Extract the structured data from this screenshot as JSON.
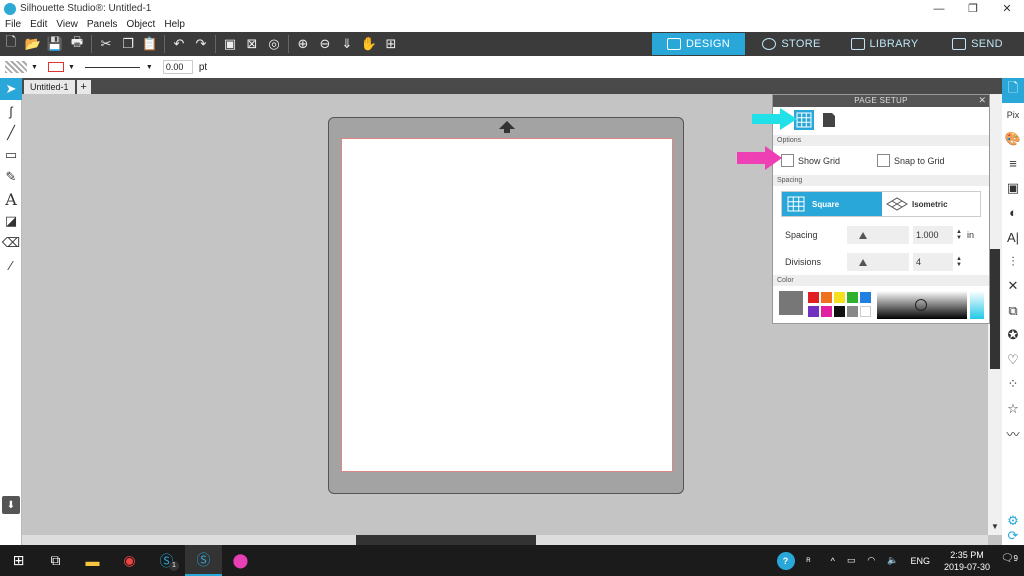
{
  "window": {
    "title": "Silhouette Studio®: Untitled-1",
    "minimize": "—",
    "maximize": "❐",
    "close": "✕"
  },
  "menu": [
    "File",
    "Edit",
    "View",
    "Panels",
    "Object",
    "Help"
  ],
  "nav_tabs": {
    "design": "DESIGN",
    "store": "STORE",
    "library": "LIBRARY",
    "send": "SEND"
  },
  "props": {
    "line_width": "0.00",
    "unit": "pt"
  },
  "doc_tab": {
    "name": "Untitled-1",
    "add": "+"
  },
  "panel": {
    "title": "PAGE SETUP",
    "options_label": "Options",
    "show_grid": "Show Grid",
    "snap_to_grid": "Snap to Grid",
    "spacing_label": "Spacing",
    "square": "Square",
    "isometric": "Isometric",
    "spacing": "Spacing",
    "spacing_value": "1.000",
    "spacing_unit": "in",
    "divisions": "Divisions",
    "divisions_value": "4",
    "color_label": "Color"
  },
  "taskbar": {
    "lang": "ENG",
    "time": "2:35 PM",
    "date": "2019-07-30",
    "notif": "9",
    "badge": "1"
  },
  "colors": {
    "accent": "#29a7d8",
    "cyan_arrow": "#22e0e8",
    "pink_arrow": "#ee3fb5"
  }
}
